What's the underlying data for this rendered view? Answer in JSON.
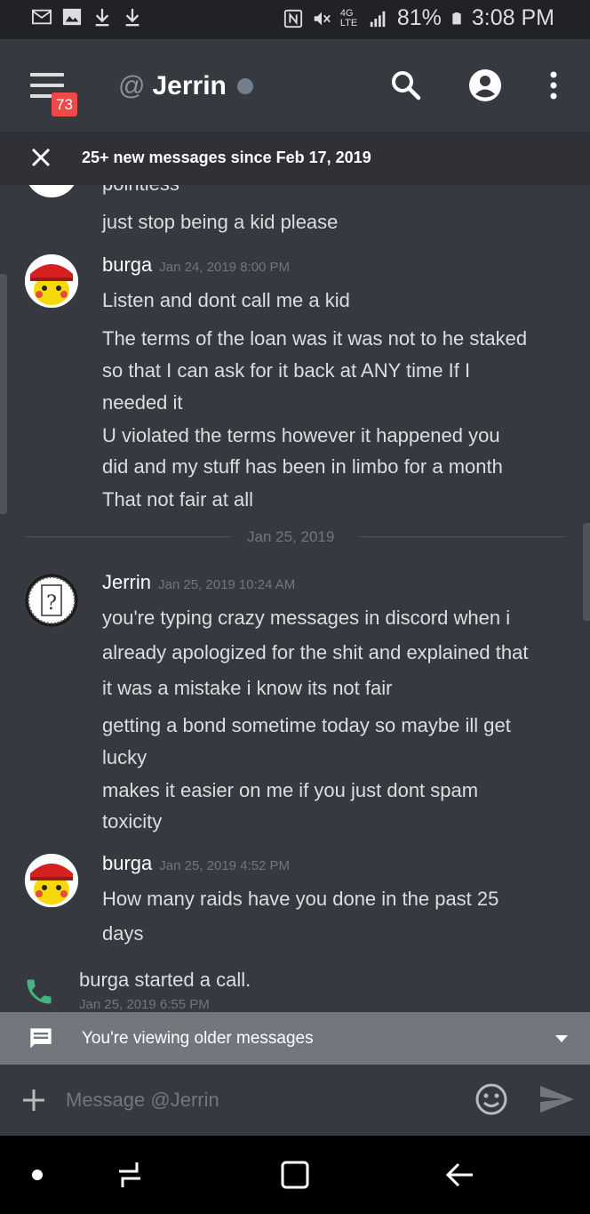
{
  "status_bar": {
    "battery": "81%",
    "time": "3:08 PM",
    "network": "4G LTE"
  },
  "header": {
    "unread_count": "73",
    "at_sign": "@",
    "channel_name": "Jerrin"
  },
  "new_messages_bar": {
    "text": "25+ new messages since Feb 17, 2019"
  },
  "messages": {
    "partial_top": "pointless",
    "line_stop": "just stop being a kid please",
    "group1": {
      "author": "burga",
      "timestamp": "Jan 24, 2019 8:00 PM",
      "lines": [
        "Listen and dont call me a kid",
        "The terms of the loan was it was not to he staked",
        "so that I can ask for it back at ANY time If I",
        "needed it",
        "U violated the terms however it happened you",
        "did and my stuff has been in limbo for a month",
        "That not fair at all"
      ]
    },
    "date_divider": "Jan 25, 2019",
    "group2": {
      "author": "Jerrin",
      "timestamp": "Jan 25, 2019 10:24 AM",
      "lines": [
        "you're typing crazy messages in discord when i",
        "already apologized for the shit and explained that",
        "it was a mistake i know its not fair",
        "getting a bond sometime today  so maybe ill get",
        "lucky",
        "makes it easier on me if you just dont spam",
        "toxicity"
      ]
    },
    "group3": {
      "author": "burga",
      "timestamp": "Jan 25, 2019 4:52 PM",
      "lines": [
        "How many raids have you done in the past 25",
        "days"
      ]
    },
    "call": {
      "text": "burga started a call.",
      "timestamp": "Jan 25, 2019 6:55 PM"
    }
  },
  "older_bar": {
    "text": "You're viewing older messages"
  },
  "composer": {
    "placeholder": "Message @Jerrin"
  },
  "colors": {
    "background": "#36393f",
    "dark": "#202225",
    "badge": "#f04747",
    "call_green": "#43b581",
    "older_bar": "#72767d"
  }
}
